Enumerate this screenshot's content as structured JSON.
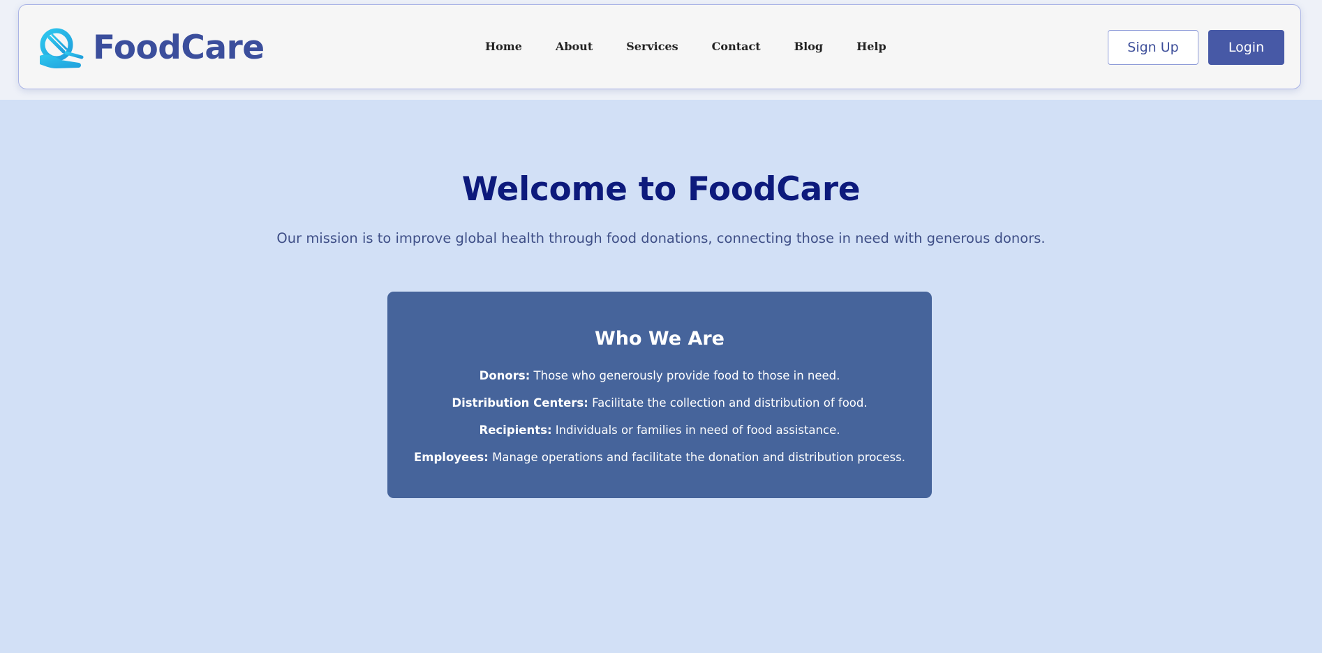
{
  "brand": {
    "name": "FoodCare",
    "icon": "foodcare-logo-icon",
    "color": "#3b4e9c",
    "icon_color": "#29b6e8"
  },
  "nav": {
    "links": [
      "Home",
      "About",
      "Services",
      "Contact",
      "Blog",
      "Help"
    ]
  },
  "auth": {
    "signup_label": "Sign Up",
    "login_label": "Login",
    "login_color": "#4759a6"
  },
  "hero": {
    "title": "Welcome to FoodCare",
    "subtitle": "Our mission is to improve global health through food donations, connecting those in need with generous donors.",
    "title_color": "#0d1a7c"
  },
  "about": {
    "title": "Who We Are",
    "card_color": "#46649b",
    "items": [
      {
        "term": "Donors:",
        "desc": " Those who generously provide food to those in need."
      },
      {
        "term": "Distribution Centers:",
        "desc": " Facilitate the collection and distribution of food."
      },
      {
        "term": "Recipients:",
        "desc": " Individuals or families in need of food assistance."
      },
      {
        "term": "Employees:",
        "desc": " Manage operations and facilitate the donation and distribution process."
      }
    ]
  },
  "background_color": "#d2e0f6"
}
